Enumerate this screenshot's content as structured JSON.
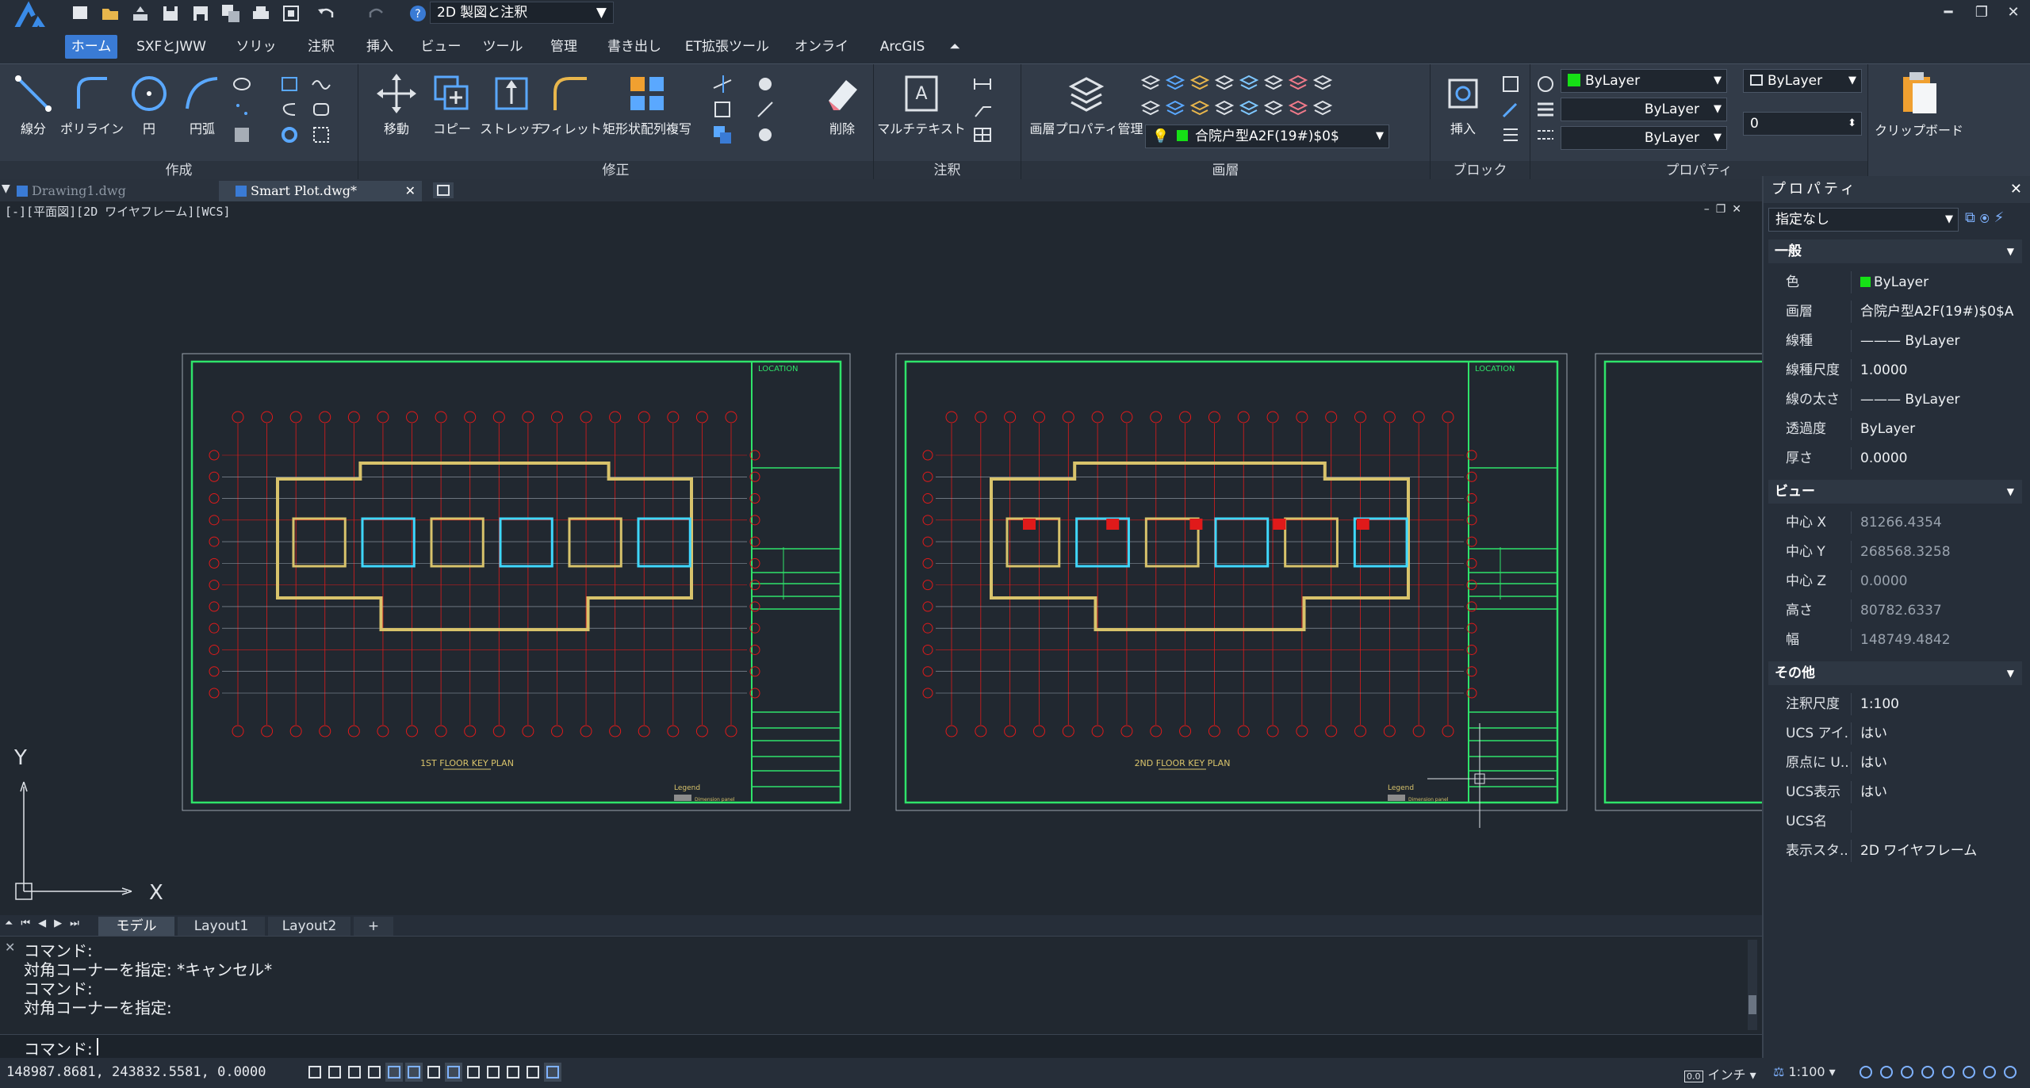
{
  "app": {
    "workspace": "2D 製図と注釈"
  },
  "ribbon_tabs": [
    "ホーム",
    "SXFとJWW",
    "ソリッド",
    "注釈",
    "挿入",
    "ビュー",
    "ツール",
    "管理",
    "書き出し",
    "ET拡張ツール",
    "オンライン",
    "ArcGIS"
  ],
  "panels": {
    "draw": "作成",
    "modify": "修正",
    "annotation": "注釈",
    "layers": "画層",
    "block": "ブロック",
    "properties": "プロパティ"
  },
  "tools": {
    "line": "線分",
    "polyline": "ポリライン",
    "circle": "円",
    "arc": "円弧",
    "move": "移動",
    "copy": "コピー",
    "stretch": "ストレッチ",
    "fillet": "フィレット",
    "array": "矩形状配列複写",
    "erase": "削除",
    "mtext": "マルチテキスト",
    "layer_props": "画層プロパティ管理",
    "insert": "挿入",
    "clipboard": "クリップボード"
  },
  "layer_current": "合院户型A2F(19#)$0$",
  "prop_combos": {
    "color": "ByLayer",
    "linetype": "ByLayer",
    "lineweight": "ByLayer",
    "plotstyle": "ByLayer",
    "transparency": "0"
  },
  "doc_tabs": [
    "Drawing1.dwg",
    "Smart Plot.dwg*"
  ],
  "viewport_label": "[-][平面図][2D ワイヤフレーム][WCS]",
  "drawing": {
    "plan1_title": "1ST FLOOR KEY PLAN",
    "plan2_title": "2ND FLOOR KEY PLAN",
    "location": "LOCATION",
    "legend": "Legend",
    "legend_item": "Dimension panel",
    "axis_x": "X",
    "axis_y": "Y"
  },
  "layout_tabs": [
    "モデル",
    "Layout1",
    "Layout2",
    "+"
  ],
  "command_history": [
    "コマンド:",
    "対角コーナーを指定: *キャンセル*",
    "コマンド:",
    "対角コーナーを指定:"
  ],
  "command_prompt": "コマンド:",
  "status": {
    "coords": "148987.8681, 243832.5581, 0.0000",
    "units": "インチ",
    "scale": "1:100"
  },
  "properties": {
    "title": "プロパティ",
    "selection": "指定なし",
    "general": {
      "header": "一般",
      "rows": [
        [
          "色",
          "ByLayer"
        ],
        [
          "画層",
          "合院户型A2F(19#)$0$A"
        ],
        [
          "線種",
          "——— ByLayer"
        ],
        [
          "線種尺度",
          "1.0000"
        ],
        [
          "線の太さ",
          "——— ByLayer"
        ],
        [
          "透過度",
          "ByLayer"
        ],
        [
          "厚さ",
          "0.0000"
        ]
      ]
    },
    "view": {
      "header": "ビュー",
      "rows": [
        [
          "中心 X",
          "81266.4354"
        ],
        [
          "中心 Y",
          "268568.3258"
        ],
        [
          "中心 Z",
          "0.0000"
        ],
        [
          "高さ",
          "80782.6337"
        ],
        [
          "幅",
          "148749.4842"
        ]
      ]
    },
    "misc": {
      "header": "その他",
      "rows": [
        [
          "注釈尺度",
          "1:100"
        ],
        [
          "UCS アイ...",
          "はい"
        ],
        [
          "原点に U...",
          "はい"
        ],
        [
          "UCS表示",
          "はい"
        ],
        [
          "UCS名",
          ""
        ],
        [
          "表示スタ...",
          "2D ワイヤフレーム"
        ]
      ]
    }
  },
  "colors": {
    "accent": "#3a7bd5",
    "layer_green": "#16e016",
    "frame_green": "#2fe36a",
    "grid_red": "#e01a1a",
    "wall_yellow": "#d8c36b"
  }
}
